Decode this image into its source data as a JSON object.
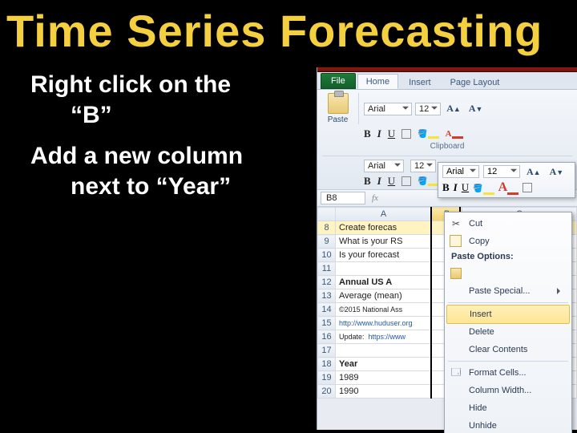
{
  "title": "Time Series Forecasting",
  "instructions": {
    "line1a": "Right click on the",
    "line1b": "“B”",
    "line2a": "Add a new column",
    "line2b": "next to “Year”"
  },
  "excel": {
    "tabs": {
      "file": "File",
      "home": "Home",
      "insert": "Insert",
      "page_layout": "Page Layout"
    },
    "ribbon": {
      "paste": "Paste",
      "clipboard_label": "Clipboard",
      "font_name": "Arial",
      "font_size": "12",
      "bold": "B",
      "italic": "I",
      "underline": "U"
    },
    "namebox": "B8",
    "columns": {
      "A": "A",
      "B": "B",
      "C": "C"
    },
    "rows": [
      {
        "n": "8",
        "a": "Create forecas",
        "bold": false
      },
      {
        "n": "9",
        "a": "What is your RS",
        "bold": false
      },
      {
        "n": "10",
        "a": "Is your forecast",
        "bold": false
      },
      {
        "n": "11",
        "a": "",
        "bold": false
      },
      {
        "n": "12",
        "a": "Annual US A",
        "bold": true
      },
      {
        "n": "13",
        "a": "Average (mean)",
        "bold": false
      },
      {
        "n": "14",
        "a": "©2015 National Ass",
        "bold": false,
        "small": true
      },
      {
        "n": "15",
        "a": "http://www.huduser.org",
        "bold": false,
        "small": true,
        "blue": true
      },
      {
        "n": "16",
        "a": "Update:  https://www",
        "bold": false,
        "small": true
      },
      {
        "n": "17",
        "a": "",
        "bold": false
      },
      {
        "n": "18",
        "a": "Year",
        "bold": true
      },
      {
        "n": "19",
        "a": "1989",
        "bold": false
      },
      {
        "n": "20",
        "a": "1990",
        "bold": false
      }
    ]
  },
  "mini": {
    "font_name": "Arial",
    "font_size": "12"
  },
  "context_menu": {
    "cut": "Cut",
    "copy": "Copy",
    "paste_options": "Paste Options:",
    "paste_special": "Paste Special...",
    "insert": "Insert",
    "delete": "Delete",
    "clear": "Clear Contents",
    "format": "Format Cells...",
    "col_width": "Column Width...",
    "hide": "Hide",
    "unhide": "Unhide"
  }
}
